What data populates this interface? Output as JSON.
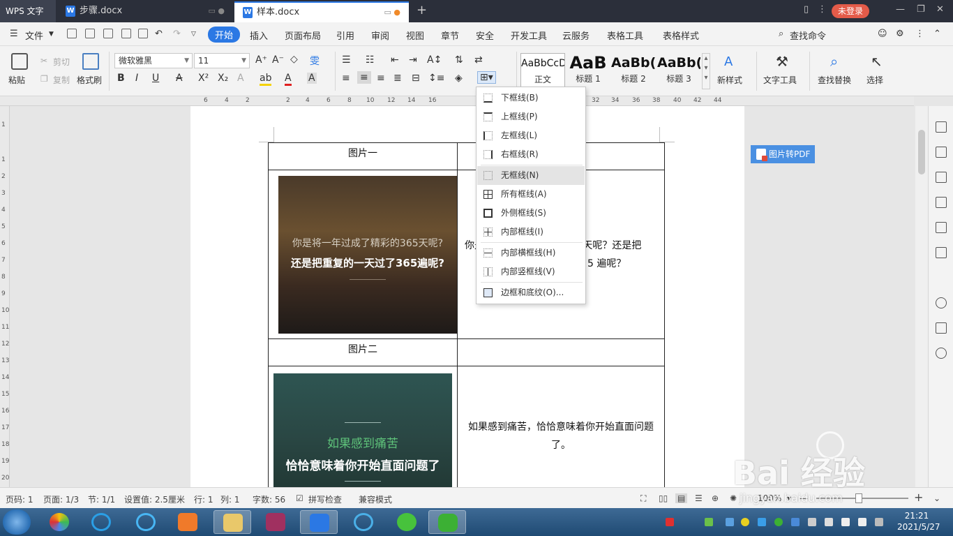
{
  "titlebar": {
    "app_name": "WPS 文字",
    "tabs": [
      {
        "label": "步骤.docx"
      },
      {
        "label": "样本.docx"
      }
    ],
    "new_tab": "+",
    "login": "未登录"
  },
  "menubar": {
    "file": "文件",
    "items": [
      "开始",
      "插入",
      "页面布局",
      "引用",
      "审阅",
      "视图",
      "章节",
      "安全",
      "开发工具",
      "云服务",
      "表格工具",
      "表格样式"
    ],
    "search": "查找命令"
  },
  "ribbon": {
    "paste": "粘贴",
    "cut": "剪切",
    "copy": "复制",
    "format_painter": "格式刷",
    "font_name": "微软雅黑",
    "font_size": "11",
    "styles": [
      {
        "preview": "AaBbCcDd",
        "caption": "正文"
      },
      {
        "preview": "AaB",
        "caption": "标题 1"
      },
      {
        "preview": "AaBb(",
        "caption": "标题 2"
      },
      {
        "preview": "AaBb(",
        "caption": "标题 3"
      }
    ],
    "new_style": "新样式",
    "text_tools": "文字工具",
    "find_replace": "查找替换",
    "select": "选择"
  },
  "ruler": {
    "h_numbers": [
      "6",
      "4",
      "2",
      "2",
      "4",
      "6",
      "8",
      "10",
      "12",
      "14",
      "16",
      "32",
      "34",
      "36",
      "38",
      "40",
      "42",
      "44"
    ],
    "v_numbers": [
      "1",
      "1",
      "2",
      "3",
      "4",
      "5",
      "6",
      "7",
      "8",
      "9",
      "10",
      "11",
      "12",
      "13",
      "14",
      "15",
      "16",
      "17",
      "18",
      "19",
      "20"
    ]
  },
  "document": {
    "table": {
      "row1_left": "图片一",
      "image1_line1": "你是将一年过成了精彩的365天呢?",
      "image1_line2": "还是把重复的一天过了365遍呢?",
      "text1_part1": "你是",
      "text1_part2": "5 天呢？还是把",
      "text1_part3": "5 遍呢？",
      "row3_left": "图片二",
      "image2_line1": "如果感到痛苦",
      "image2_line2": "恰恰意味着你开始直面问题了",
      "text2_line1": "如果感到痛苦，恰恰意味着你开始直面问题",
      "text2_line2": "了。"
    }
  },
  "pdf_button": "图片转PDF",
  "border_menu": {
    "items": [
      {
        "label": "下框线(B)"
      },
      {
        "label": "上框线(P)"
      },
      {
        "label": "左框线(L)"
      },
      {
        "label": "右框线(R)"
      },
      {
        "label": "无框线(N)"
      },
      {
        "label": "所有框线(A)"
      },
      {
        "label": "外侧框线(S)"
      },
      {
        "label": "内部框线(I)"
      },
      {
        "label": "内部横框线(H)"
      },
      {
        "label": "内部竖框线(V)"
      },
      {
        "label": "边框和底纹(O)..."
      }
    ]
  },
  "statusbar": {
    "page_code": "页码: 1",
    "page": "页面: 1/3",
    "section": "节: 1/1",
    "setting": "设置值: 2.5厘米",
    "row": "行: 1",
    "col": "列: 1",
    "words": "字数: 56",
    "spell": "拼写检查",
    "compat": "兼容模式",
    "zoom": "100%"
  },
  "taskbar": {
    "time": "21:21",
    "date": "2021/5/27"
  },
  "watermark": {
    "brand": "Bai 经验",
    "url": "jingyan.baidu.com"
  },
  "colors": {
    "accent": "#2b78e4",
    "titlebar": "#2b2f3a",
    "login_badge": "#e35b49"
  }
}
